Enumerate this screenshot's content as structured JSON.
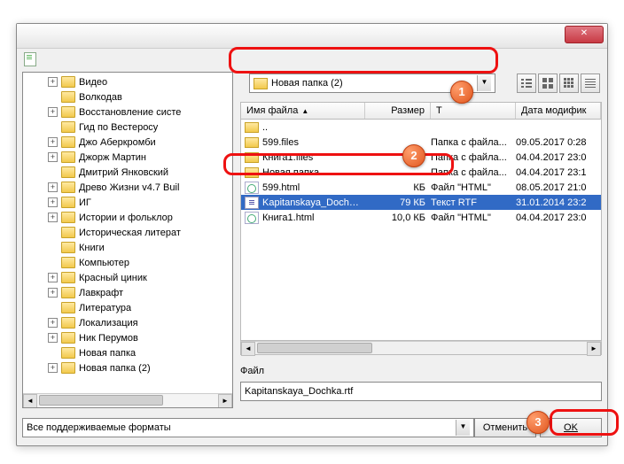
{
  "titlebar": {
    "close": "close"
  },
  "location": {
    "current": "Новая папка (2)"
  },
  "viewmodes": [
    "list",
    "large-icons",
    "small-icons",
    "details"
  ],
  "tree": {
    "items": [
      {
        "exp": "+",
        "label": "Видео"
      },
      {
        "exp": "",
        "label": "Волкодав"
      },
      {
        "exp": "+",
        "label": "Восстановление систе"
      },
      {
        "exp": "",
        "label": "Гид по Вестеросу"
      },
      {
        "exp": "+",
        "label": "Джо Аберкромби"
      },
      {
        "exp": "+",
        "label": "Джорж Мартин"
      },
      {
        "exp": "",
        "label": "Дмитрий Янковский"
      },
      {
        "exp": "+",
        "label": "Древо Жизни v4.7 Buil"
      },
      {
        "exp": "+",
        "label": "ИГ"
      },
      {
        "exp": "+",
        "label": "Истории и фольклор"
      },
      {
        "exp": "",
        "label": "Историческая литерат"
      },
      {
        "exp": "",
        "label": "Книги"
      },
      {
        "exp": "",
        "label": "Компьютер"
      },
      {
        "exp": "+",
        "label": "Красный циник"
      },
      {
        "exp": "+",
        "label": "Лавкрафт"
      },
      {
        "exp": "",
        "label": "Литература"
      },
      {
        "exp": "+",
        "label": "Локализация"
      },
      {
        "exp": "+",
        "label": "Ник Перумов"
      },
      {
        "exp": "",
        "label": "Новая папка"
      },
      {
        "exp": "+",
        "label": "Новая папка (2)"
      }
    ]
  },
  "columns": {
    "name": "Имя файла",
    "size": "Размер",
    "type": "Т",
    "date": "Дата модифик"
  },
  "files": [
    {
      "icon": "folder",
      "name": "..",
      "size": "",
      "type": "",
      "date": ""
    },
    {
      "icon": "folder",
      "name": "599.files",
      "size": "",
      "type": "Папка с файла...",
      "date": "09.05.2017 0:28"
    },
    {
      "icon": "folder",
      "name": "Книга1.files",
      "size": "",
      "type": "Папка с файла...",
      "date": "04.04.2017 23:0"
    },
    {
      "icon": "folder",
      "name": "Новая папка",
      "size": "",
      "type": "Папка с файла...",
      "date": "04.04.2017 23:1"
    },
    {
      "icon": "html",
      "name": "599.html",
      "size": "КБ",
      "type": "Файл \"HTML\"",
      "date": "08.05.2017 21:0"
    },
    {
      "icon": "rtf",
      "name": "Kapitanskaya_Dochk...",
      "size": "79 КБ",
      "type": "Текст RTF",
      "date": "31.01.2014 23:2",
      "selected": true
    },
    {
      "icon": "html",
      "name": "Книга1.html",
      "size": "10,0 КБ",
      "type": "Файл \"HTML\"",
      "date": "04.04.2017 23:0"
    }
  ],
  "filefield": {
    "label": "Файл",
    "value": "Kapitanskaya_Dochka.rtf"
  },
  "format": {
    "value": "Все поддерживаемые форматы"
  },
  "buttons": {
    "cancel": "Отменить",
    "ok": "OK"
  },
  "badges": {
    "b1": "1",
    "b2": "2",
    "b3": "3"
  }
}
